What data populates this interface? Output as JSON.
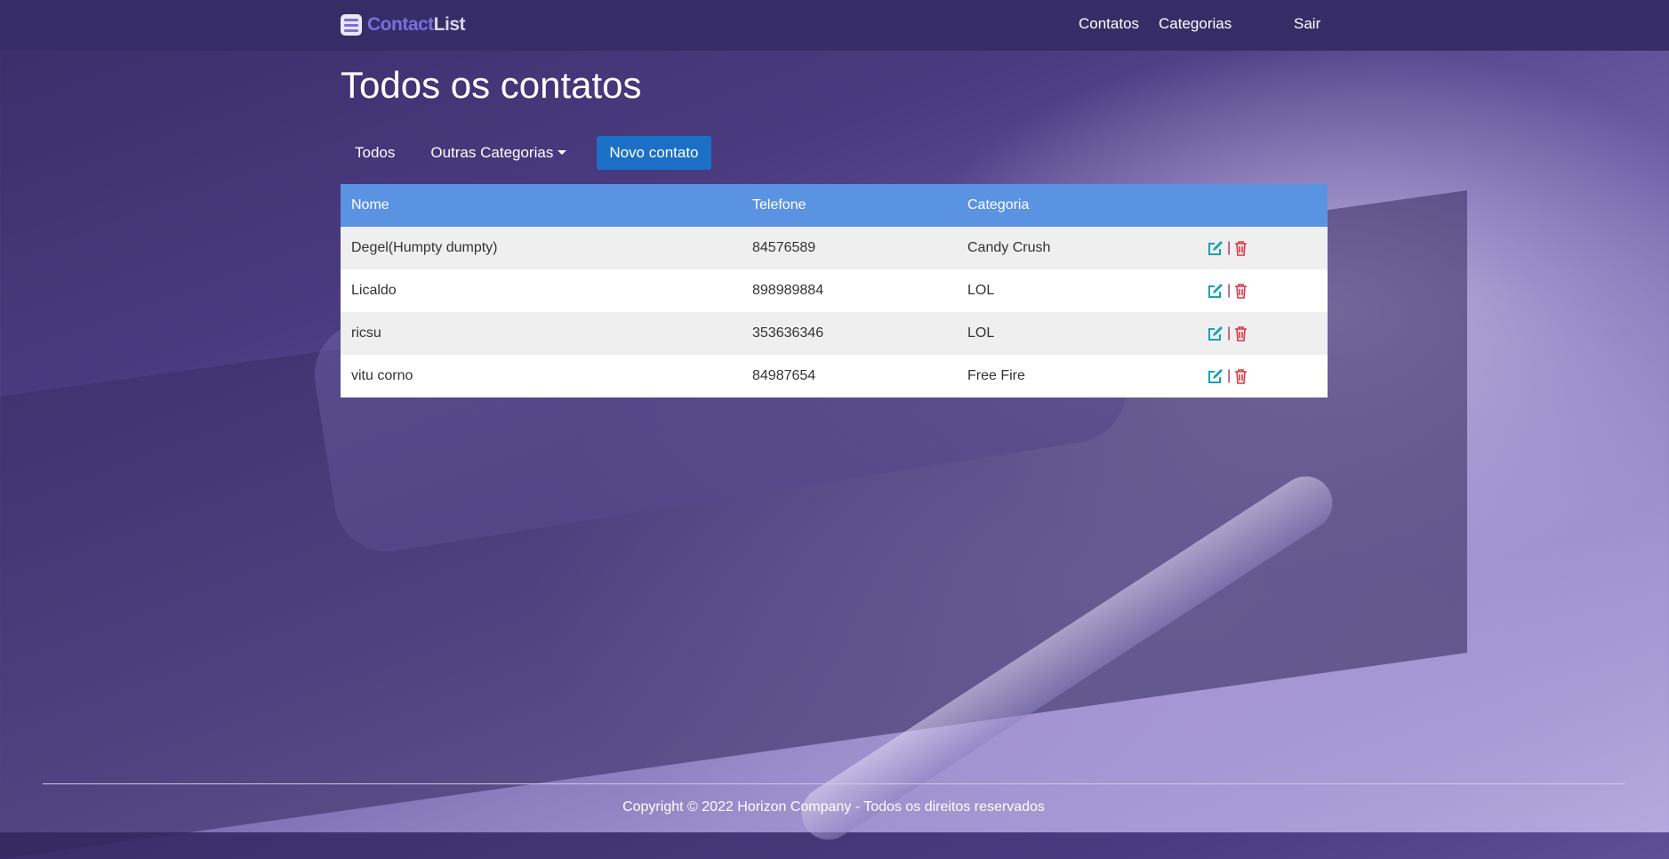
{
  "nav": {
    "brand_a": "Contact",
    "brand_b": "List",
    "links": [
      "Contatos",
      "Categorias",
      "Sair"
    ]
  },
  "page": {
    "title": "Todos os contatos",
    "filters": {
      "all": "Todos",
      "other": "Outras Categorias"
    },
    "new_button": "Novo contato"
  },
  "table": {
    "headers": [
      "Nome",
      "Telefone",
      "Categoria"
    ],
    "rows": [
      {
        "name": "Degel(Humpty dumpty)",
        "phone": "84576589",
        "category": "Candy Crush"
      },
      {
        "name": "Licaldo",
        "phone": "898989884",
        "category": "LOL"
      },
      {
        "name": "ricsu",
        "phone": "353636346",
        "category": "LOL"
      },
      {
        "name": "vitu corno",
        "phone": "84987654",
        "category": "Free Fire"
      }
    ],
    "separator": "|"
  },
  "footer": {
    "text": "Copyright © 2022 Horizon Company - Todos os direitos reservados"
  },
  "colors": {
    "nav": "#372d66",
    "header": "#5b93e3",
    "primary": "#1b6fc6",
    "edit": "#17a2b8",
    "delete": "#dc3545"
  }
}
